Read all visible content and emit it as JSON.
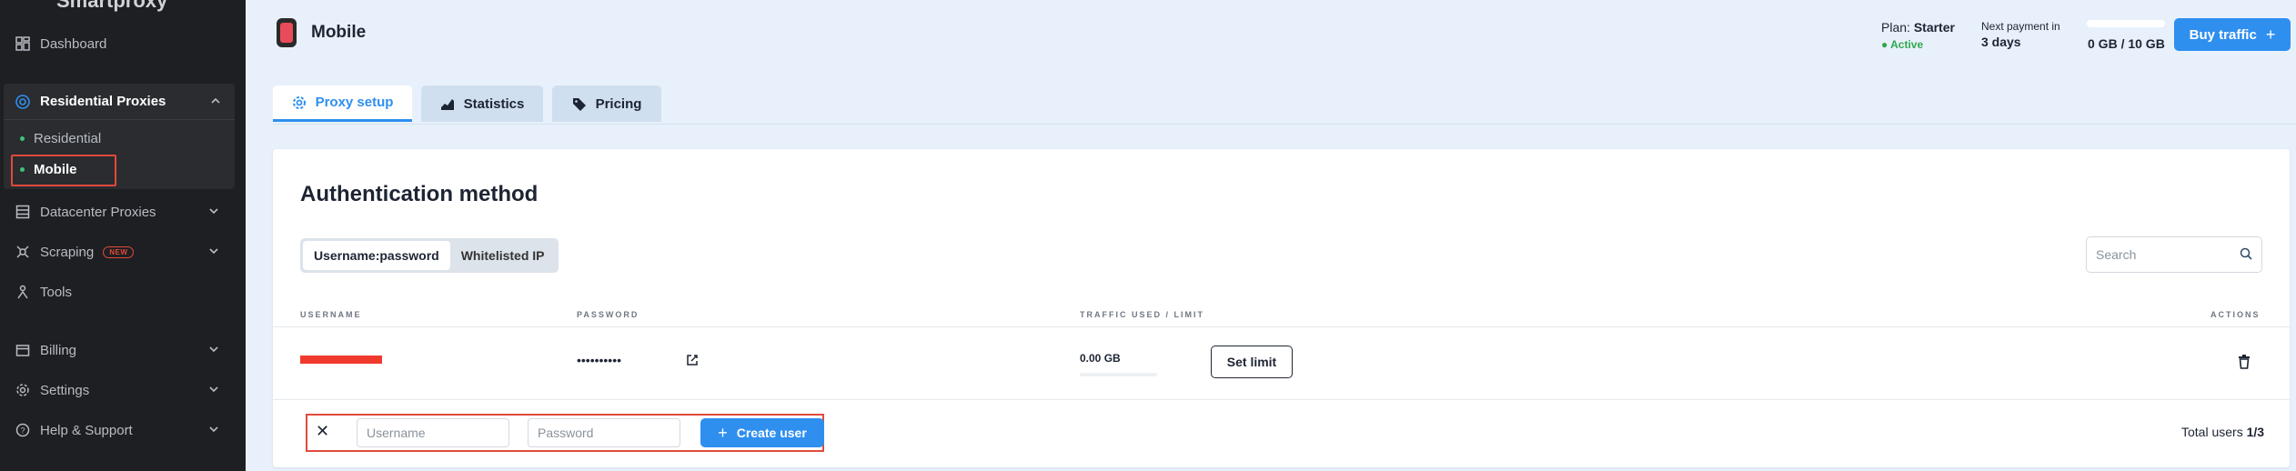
{
  "sidebar": {
    "logo_fragment": "Smartproxy",
    "dashboard": "Dashboard",
    "residential_proxies": "Residential Proxies",
    "sub_items": [
      {
        "label": "Residential"
      },
      {
        "label": "Mobile"
      }
    ],
    "datacenter_proxies": "Datacenter Proxies",
    "scraping": "Scraping",
    "scraping_badge": "NEW",
    "tools": "Tools",
    "billing": "Billing",
    "settings": "Settings",
    "help": "Help & Support"
  },
  "header": {
    "title": "Mobile",
    "plan_label": "Plan:",
    "plan_name": "Starter",
    "plan_status": "Active",
    "next_payment_label": "Next payment in",
    "next_payment_value": "3 days",
    "traffic_used": "0 GB / 10 GB",
    "traffic_fraction": 0.0,
    "buy_label": "Buy traffic"
  },
  "tabs": [
    {
      "label": "Proxy setup",
      "active": true
    },
    {
      "label": "Statistics",
      "active": false
    },
    {
      "label": "Pricing",
      "active": false
    }
  ],
  "card": {
    "title": "Authentication method",
    "auth_options": [
      "Username:password",
      "Whitelisted IP"
    ],
    "search_placeholder": "Search",
    "columns": {
      "username": "USERNAME",
      "password": "PASSWORD",
      "traffic": "TRAFFIC USED / LIMIT",
      "actions": "ACTIONS"
    },
    "row": {
      "password": "••••••••••",
      "traffic": "0.00 GB",
      "set_limit": "Set limit"
    },
    "create": {
      "username_placeholder": "Username",
      "password_placeholder": "Password",
      "button": "Create user"
    },
    "total_label": "Total users",
    "total_value": "1/3"
  },
  "colors": {
    "accent": "#2f8fef",
    "sidebar_bg": "#1e1f22",
    "active_status": "#2fa84f",
    "highlight": "#e14a3b"
  }
}
